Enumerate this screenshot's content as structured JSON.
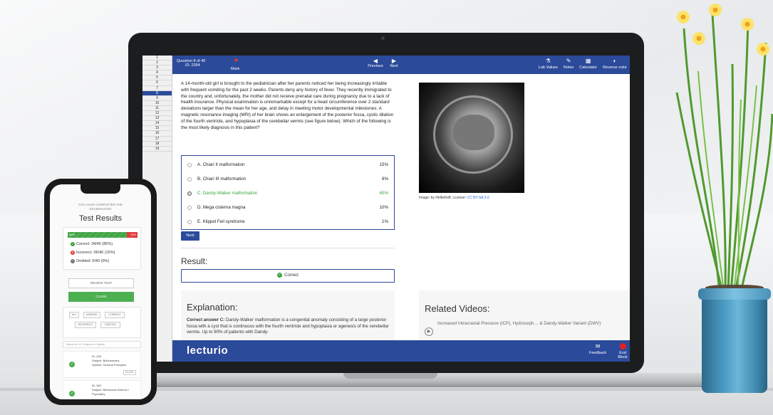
{
  "colors": {
    "brand": "#2b4a9a",
    "correct": "#3aa53a",
    "incorrect": "#e03c3c",
    "omitted": "#777777"
  },
  "question_numbers": [
    "1",
    "2",
    "3",
    "4",
    "5",
    "6",
    "7",
    "8",
    "9",
    "10",
    "11",
    "12",
    "13",
    "14",
    "15",
    "16",
    "17",
    "18",
    "19"
  ],
  "active_question_index": 7,
  "topbar": {
    "question_label": "Question 8 of 40",
    "id_label": "ID: 2394",
    "mark_label": "Mark",
    "previous_label": "Previous",
    "next_label": "Next",
    "tools": [
      {
        "label": "Lab Values",
        "icon": "flask-icon"
      },
      {
        "label": "Notes",
        "icon": "notes-icon"
      },
      {
        "label": "Calculator",
        "icon": "calculator-icon"
      },
      {
        "label": "Reverse color",
        "icon": "contrast-icon"
      }
    ]
  },
  "question_text": "A 14-month-old girl is brought to the pediatrician after her parents noticed her being increasingly irritable with frequent vomiting for the past 2 weeks. Parents deny any history of fever. They recently immigrated to the country and, unfortunately, the mother did not receive prenatal care during pregnancy due to a lack of health insurance. Physical examination is unremarkable except for a head circumference over 2 standard deviations larger than the mean for her age, and delay in meeting motor developmental milestones. A magnetic resonance imaging (MRI) of her brain shows an enlargement of the posterior fossa, cystic dilation of the fourth ventricle, and hypoplasia of the cerebellar vermis (see figure below). Which of the following is the most likely diagnosis in this patient?",
  "image_caption": {
    "prefix": "Image: by Hellerhoff, License:",
    "link": "CC BY-SA 3.0"
  },
  "answers": [
    {
      "label": "A. Chiari II malformation",
      "pct": "15%",
      "selected": false,
      "correct": false
    },
    {
      "label": "B. Chiari III malformation",
      "pct": "6%",
      "selected": false,
      "correct": false
    },
    {
      "label": "C. Dandy-Walker malformation",
      "pct": "65%",
      "selected": true,
      "correct": true
    },
    {
      "label": "D. Mega cisterna magna",
      "pct": "10%",
      "selected": false,
      "correct": false
    },
    {
      "label": "E. Klippel Feil syndrome",
      "pct": "1%",
      "selected": false,
      "correct": false
    }
  ],
  "next_button": "Next",
  "result": {
    "heading": "Result:",
    "status": "Correct"
  },
  "explanation": {
    "heading": "Explanation:",
    "lead": "Correct answer C:",
    "text": " Dandy-Walker malformation is a congenital anomaly consisting of a large posterior fossa with a cyst that is continuous with the fourth ventricle and hypoplasia or agenesis of the cerebellar vermis. Up to 90% of patients with Dandy-"
  },
  "related": {
    "heading": "Related Videos:",
    "video_title": "Increased Intracranial Pressure (ICP), Hydroceph… & Dandy-Walker Variant (DWV)"
  },
  "footer": {
    "logo": "lecturio",
    "feedback": "Feedback",
    "end_block": "End Block"
  },
  "phone": {
    "completed_text_1": "YOU HAVE COMPLETED THE",
    "completed_text_2": "EXAMINATION",
    "title": "Test Results",
    "bar": {
      "correct_fraction": 0.85,
      "left_label": "85%",
      "right_label": "15%"
    },
    "stats": [
      {
        "label": "Correct: 34/40 (85%)",
        "color": "#3aa53a",
        "mark": "✓"
      },
      {
        "label": "Incorrect: 06/40 (15%)",
        "color": "#e03c3c",
        "mark": "✕"
      },
      {
        "label": "Omitted: 0/40 (0%)",
        "color": "#777777",
        "mark": "−"
      }
    ],
    "review_button": "REVIEW TEST",
    "close_button": "CLOSE",
    "filters_row1": [
      "ALL",
      "MARKED",
      "CORRECT"
    ],
    "filters_row2": [
      "INCORRECT",
      "OMITTED"
    ],
    "search_placeholder": "Search for ID, Subjects or System",
    "items": [
      {
        "id": "ID: 206",
        "subject": "Subject: Biochemistry",
        "system": "System: General Principles",
        "status": "BLANK"
      },
      {
        "id": "ID: 962",
        "subject": "Subject: Behavioral Science /",
        "system": "Psychiatry",
        "status": ""
      }
    ]
  }
}
